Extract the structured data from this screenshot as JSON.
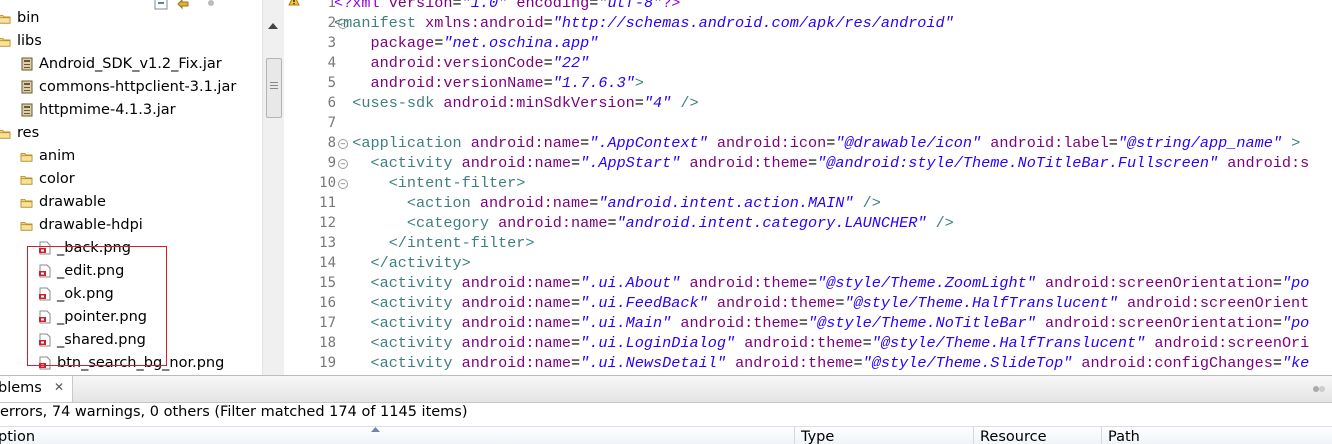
{
  "explorer": {
    "items": [
      {
        "label": "bin",
        "kind": "folder"
      },
      {
        "label": "libs",
        "kind": "folder"
      },
      {
        "label": "Android_SDK_v1.2_Fix.jar",
        "kind": "jar"
      },
      {
        "label": "commons-httpclient-3.1.jar",
        "kind": "jar"
      },
      {
        "label": "httpmime-4.1.3.jar",
        "kind": "jar"
      },
      {
        "label": "res",
        "kind": "folder"
      },
      {
        "label": "anim",
        "kind": "folder"
      },
      {
        "label": "color",
        "kind": "folder"
      },
      {
        "label": "drawable",
        "kind": "folder"
      },
      {
        "label": "drawable-hdpi",
        "kind": "folder"
      },
      {
        "label": "_back.png",
        "kind": "png"
      },
      {
        "label": "_edit.png",
        "kind": "png"
      },
      {
        "label": "_ok.png",
        "kind": "png"
      },
      {
        "label": "_pointer.png",
        "kind": "png"
      },
      {
        "label": "_shared.png",
        "kind": "png"
      },
      {
        "label": "btn_search_bg_nor.png",
        "kind": "png"
      }
    ]
  },
  "editor": {
    "line_numbers": [
      "1",
      "2",
      "3",
      "4",
      "5",
      "6",
      "7",
      "8",
      "9",
      "10",
      "11",
      "12",
      "13",
      "14",
      "15",
      "16",
      "17",
      "18",
      "19"
    ],
    "lines": [
      [
        {
          "c": "pi",
          "t": "<?xml "
        },
        {
          "c": "a",
          "t": "version"
        },
        {
          "c": "p",
          "t": "="
        },
        {
          "c": "v",
          "t": "\"1.0\""
        },
        {
          "c": "p",
          "t": " "
        },
        {
          "c": "a",
          "t": "encoding"
        },
        {
          "c": "p",
          "t": "="
        },
        {
          "c": "v",
          "t": "\"utf-8\""
        },
        {
          "c": "pi",
          "t": "?>"
        }
      ],
      [
        {
          "c": "t",
          "t": "<manifest "
        },
        {
          "c": "a",
          "t": "xmlns:android"
        },
        {
          "c": "p",
          "t": "="
        },
        {
          "c": "v",
          "t": "\"http://schemas.android.com/apk/res/android\""
        }
      ],
      [
        {
          "c": "p",
          "t": "    "
        },
        {
          "c": "a",
          "t": "package"
        },
        {
          "c": "p",
          "t": "="
        },
        {
          "c": "v",
          "t": "\"net.oschina.app\""
        }
      ],
      [
        {
          "c": "p",
          "t": "    "
        },
        {
          "c": "a",
          "t": "android:versionCode"
        },
        {
          "c": "p",
          "t": "="
        },
        {
          "c": "v",
          "t": "\"22\""
        }
      ],
      [
        {
          "c": "p",
          "t": "    "
        },
        {
          "c": "a",
          "t": "android:versionName"
        },
        {
          "c": "p",
          "t": "="
        },
        {
          "c": "v",
          "t": "\"1.7.6.3\""
        },
        {
          "c": "t",
          "t": ">"
        }
      ],
      [
        {
          "c": "p",
          "t": "  "
        },
        {
          "c": "t",
          "t": "<uses-sdk "
        },
        {
          "c": "a",
          "t": "android:minSdkVersion"
        },
        {
          "c": "p",
          "t": "="
        },
        {
          "c": "v",
          "t": "\"4\""
        },
        {
          "c": "t",
          "t": " />"
        }
      ],
      [
        {
          "c": "p",
          "t": ""
        }
      ],
      [
        {
          "c": "p",
          "t": "  "
        },
        {
          "c": "t",
          "t": "<application "
        },
        {
          "c": "a",
          "t": "android:name"
        },
        {
          "c": "p",
          "t": "="
        },
        {
          "c": "v",
          "t": "\".AppContext\""
        },
        {
          "c": "p",
          "t": " "
        },
        {
          "c": "a",
          "t": "android:icon"
        },
        {
          "c": "p",
          "t": "="
        },
        {
          "c": "v",
          "t": "\"@drawable/icon\""
        },
        {
          "c": "p",
          "t": " "
        },
        {
          "c": "a",
          "t": "android:label"
        },
        {
          "c": "p",
          "t": "="
        },
        {
          "c": "v",
          "t": "\"@string/app_name\""
        },
        {
          "c": "t",
          "t": " >"
        }
      ],
      [
        {
          "c": "p",
          "t": "    "
        },
        {
          "c": "t",
          "t": "<activity "
        },
        {
          "c": "a",
          "t": "android:name"
        },
        {
          "c": "p",
          "t": "="
        },
        {
          "c": "v",
          "t": "\".AppStart\""
        },
        {
          "c": "p",
          "t": " "
        },
        {
          "c": "a",
          "t": "android:theme"
        },
        {
          "c": "p",
          "t": "="
        },
        {
          "c": "v",
          "t": "\"@android:style/Theme.NoTitleBar.Fullscreen\""
        },
        {
          "c": "p",
          "t": " "
        },
        {
          "c": "a",
          "t": "android:s"
        }
      ],
      [
        {
          "c": "p",
          "t": "      "
        },
        {
          "c": "t",
          "t": "<intent-filter>"
        }
      ],
      [
        {
          "c": "p",
          "t": "        "
        },
        {
          "c": "t",
          "t": "<action "
        },
        {
          "c": "a",
          "t": "android:name"
        },
        {
          "c": "p",
          "t": "="
        },
        {
          "c": "v",
          "t": "\"android.intent.action.MAIN\""
        },
        {
          "c": "t",
          "t": " />"
        }
      ],
      [
        {
          "c": "p",
          "t": "        "
        },
        {
          "c": "t",
          "t": "<category "
        },
        {
          "c": "a",
          "t": "android:name"
        },
        {
          "c": "p",
          "t": "="
        },
        {
          "c": "v",
          "t": "\"android.intent.category.LAUNCHER\""
        },
        {
          "c": "t",
          "t": " />"
        }
      ],
      [
        {
          "c": "p",
          "t": "      "
        },
        {
          "c": "t",
          "t": "</intent-filter>"
        }
      ],
      [
        {
          "c": "p",
          "t": "    "
        },
        {
          "c": "t",
          "t": "</activity>"
        }
      ],
      [
        {
          "c": "p",
          "t": "    "
        },
        {
          "c": "t",
          "t": "<activity "
        },
        {
          "c": "a",
          "t": "android:name"
        },
        {
          "c": "p",
          "t": "="
        },
        {
          "c": "v",
          "t": "\".ui.About\""
        },
        {
          "c": "p",
          "t": " "
        },
        {
          "c": "a",
          "t": "android:theme"
        },
        {
          "c": "p",
          "t": "="
        },
        {
          "c": "v",
          "t": "\"@style/Theme.ZoomLight\""
        },
        {
          "c": "p",
          "t": " "
        },
        {
          "c": "a",
          "t": "android:screenOrientation"
        },
        {
          "c": "p",
          "t": "="
        },
        {
          "c": "v",
          "t": "\"po"
        }
      ],
      [
        {
          "c": "p",
          "t": "    "
        },
        {
          "c": "t",
          "t": "<activity "
        },
        {
          "c": "a",
          "t": "android:name"
        },
        {
          "c": "p",
          "t": "="
        },
        {
          "c": "v",
          "t": "\".ui.FeedBack\""
        },
        {
          "c": "p",
          "t": " "
        },
        {
          "c": "a",
          "t": "android:theme"
        },
        {
          "c": "p",
          "t": "="
        },
        {
          "c": "v",
          "t": "\"@style/Theme.HalfTranslucent\""
        },
        {
          "c": "p",
          "t": " "
        },
        {
          "c": "a",
          "t": "android:screenOrient"
        }
      ],
      [
        {
          "c": "p",
          "t": "    "
        },
        {
          "c": "t",
          "t": "<activity "
        },
        {
          "c": "a",
          "t": "android:name"
        },
        {
          "c": "p",
          "t": "="
        },
        {
          "c": "v",
          "t": "\".ui.Main\""
        },
        {
          "c": "p",
          "t": " "
        },
        {
          "c": "a",
          "t": "android:theme"
        },
        {
          "c": "p",
          "t": "="
        },
        {
          "c": "v",
          "t": "\"@style/Theme.NoTitleBar\""
        },
        {
          "c": "p",
          "t": " "
        },
        {
          "c": "a",
          "t": "android:screenOrientation"
        },
        {
          "c": "p",
          "t": "="
        },
        {
          "c": "v",
          "t": "\"po"
        }
      ],
      [
        {
          "c": "p",
          "t": "    "
        },
        {
          "c": "t",
          "t": "<activity "
        },
        {
          "c": "a",
          "t": "android:name"
        },
        {
          "c": "p",
          "t": "="
        },
        {
          "c": "v",
          "t": "\".ui.LoginDialog\""
        },
        {
          "c": "p",
          "t": " "
        },
        {
          "c": "a",
          "t": "android:theme"
        },
        {
          "c": "p",
          "t": "="
        },
        {
          "c": "v",
          "t": "\"@style/Theme.HalfTranslucent\""
        },
        {
          "c": "p",
          "t": " "
        },
        {
          "c": "a",
          "t": "android:screenOri"
        }
      ],
      [
        {
          "c": "p",
          "t": "    "
        },
        {
          "c": "t",
          "t": "<activity "
        },
        {
          "c": "a",
          "t": "android:name"
        },
        {
          "c": "p",
          "t": "="
        },
        {
          "c": "v",
          "t": "\".ui.NewsDetail\""
        },
        {
          "c": "p",
          "t": " "
        },
        {
          "c": "a",
          "t": "android:theme"
        },
        {
          "c": "p",
          "t": "="
        },
        {
          "c": "v",
          "t": "\"@style/Theme.SlideTop\""
        },
        {
          "c": "p",
          "t": " "
        },
        {
          "c": "a",
          "t": "android:configChanges"
        },
        {
          "c": "p",
          "t": "="
        },
        {
          "c": "v",
          "t": "\"ke"
        }
      ]
    ]
  },
  "problems": {
    "tab_label": "blems",
    "summary": "errors, 74 warnings, 0 others (Filter matched 174 of 1145 items)",
    "columns": {
      "description": "iption",
      "type": "Type",
      "resource": "Resource",
      "path": "Path"
    }
  },
  "colors": {
    "tag": "#3f7f7f",
    "attribute": "#7f007f",
    "value": "#2a00ff",
    "highlight_box": "#d0202b"
  }
}
